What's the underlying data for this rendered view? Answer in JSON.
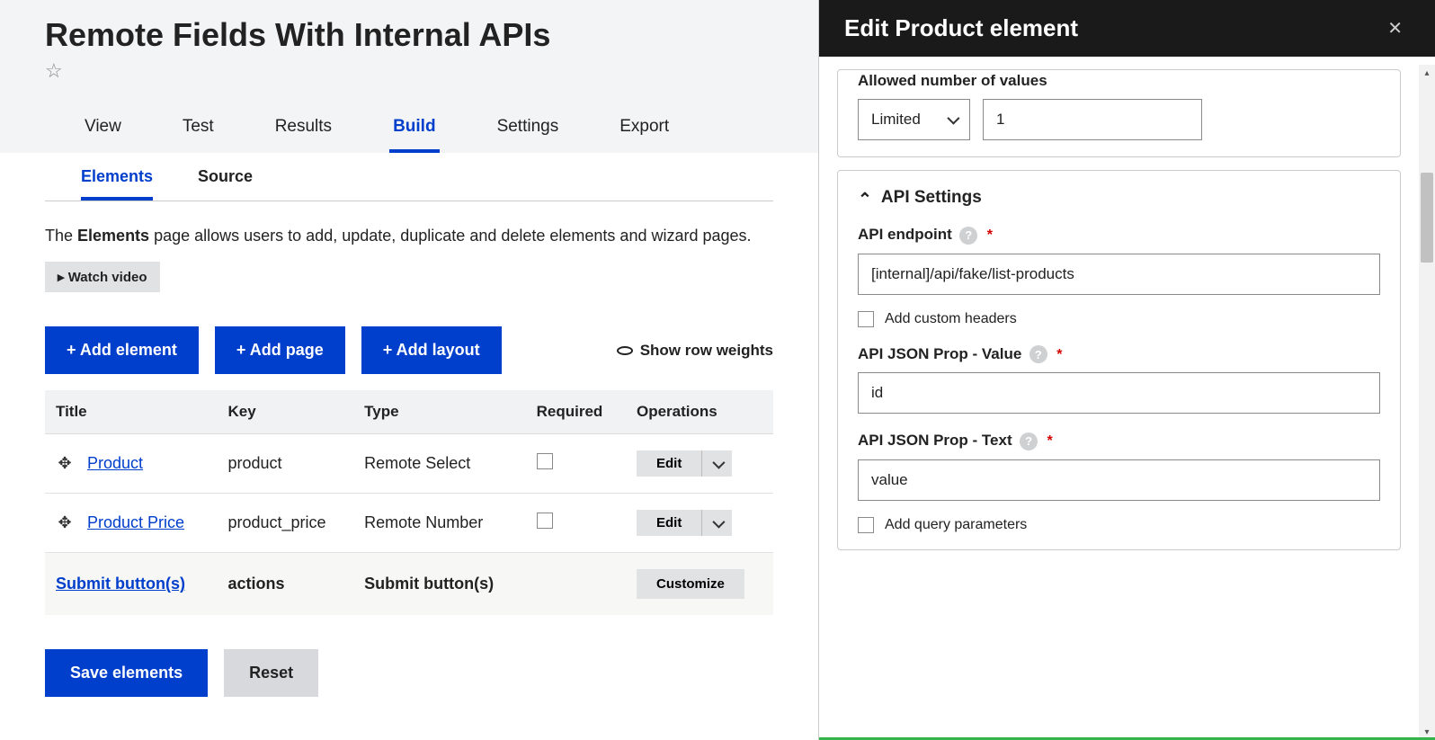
{
  "page": {
    "title": "Remote Fields With Internal APIs",
    "intro_prefix": "The ",
    "intro_bold": "Elements",
    "intro_suffix": " page allows users to add, update, duplicate and delete elements and wizard pages.",
    "watch_video": "▸ Watch video",
    "show_row_weights": "Show row weights"
  },
  "main_tabs": [
    "View",
    "Test",
    "Results",
    "Build",
    "Settings",
    "Export"
  ],
  "sub_tabs": [
    "Elements",
    "Source"
  ],
  "actions": {
    "add_element": "+ Add element",
    "add_page": "+ Add page",
    "add_layout": "+ Add layout",
    "save": "Save elements",
    "reset": "Reset"
  },
  "table": {
    "headers": [
      "Title",
      "Key",
      "Type",
      "Required",
      "Operations"
    ],
    "edit_label": "Edit",
    "customize_label": "Customize",
    "rows": [
      {
        "title": "Product",
        "key": "product",
        "type": "Remote Select"
      },
      {
        "title": "Product Price",
        "key": "product_price",
        "type": "Remote Number"
      }
    ],
    "submit_row": {
      "title": "Submit button(s)",
      "key": "actions",
      "type": "Submit button(s)"
    }
  },
  "panel": {
    "title": "Edit Product element",
    "allowed_label": "Allowed number of values",
    "allowed_mode": "Limited",
    "allowed_value": "1",
    "api_section": "API Settings",
    "endpoint_label": "API endpoint",
    "endpoint_value": "[internal]/api/fake/list-products",
    "custom_headers_label": "Add custom headers",
    "prop_value_label": "API JSON Prop - Value",
    "prop_value_value": "id",
    "prop_text_label": "API JSON Prop - Text",
    "prop_text_value": "value",
    "query_params_label": "Add query parameters"
  }
}
